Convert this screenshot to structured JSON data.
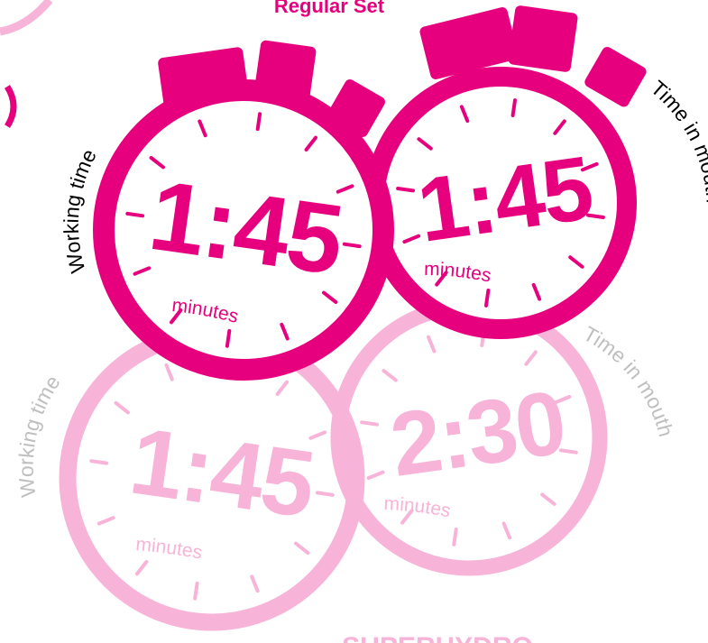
{
  "colors": {
    "magenta": "#e6007e",
    "light_pink": "#f7b4d8",
    "label_dark": "#000000",
    "label_light": "#bfbfbf"
  },
  "headings": {
    "top": "Regular Set",
    "bottom": "SUPERHYDRO"
  },
  "timers": {
    "regular": {
      "working": {
        "time": "1:45",
        "unit": "minutes",
        "caption": "Working time"
      },
      "mouth": {
        "time": "1:45",
        "unit": "minutes",
        "caption": "Time in mouth"
      }
    },
    "superhydro": {
      "working": {
        "time": "1:45",
        "unit": "minutes",
        "caption": "Working time"
      },
      "mouth": {
        "time": "2:30",
        "unit": "minutes",
        "caption": "Time in mouth"
      }
    }
  },
  "icons": {
    "stopwatch": "stopwatch-icon",
    "tick": "tick-mark"
  }
}
